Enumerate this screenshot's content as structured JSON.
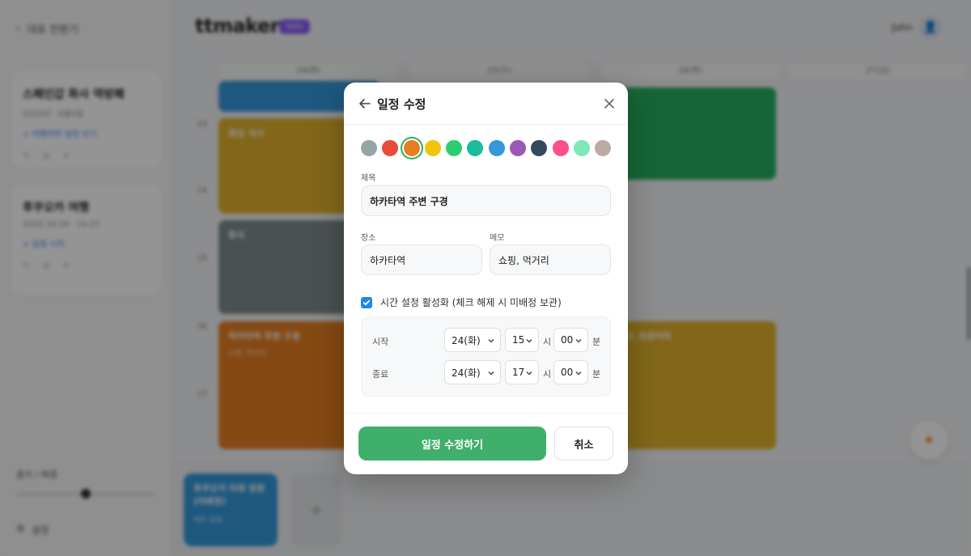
{
  "background": {
    "sidebar": {
      "back_label": "대표 전환기",
      "trips": [
        {
          "title": "스페인갑 화사 역방폐",
          "date": "2025년 · 8월9일",
          "link": "> 여행하면 일정 보기"
        },
        {
          "title": "후쿠오카 여행",
          "date": "2025.10.24 · 10.27",
          "link": "> 일정 시작"
        }
      ],
      "zoom_label": "출처 / 빠름",
      "settings_label": "설정"
    },
    "header": {
      "logo": "ttmaker",
      "badge": "beta",
      "user_name": "John"
    },
    "day_headers": [
      "24(화)",
      "25(수)",
      "26(목)",
      "27(금)"
    ],
    "time_labels": [
      "13",
      "14",
      "15",
      "16",
      "17"
    ],
    "events": [
      {
        "title": "",
        "sub": "",
        "color": "#3498db"
      },
      {
        "title": "점심 식사",
        "sub": "",
        "color": "#e1b12c"
      },
      {
        "title": "",
        "sub": "",
        "color": "#27ae60"
      },
      {
        "title": "휴식",
        "sub": "",
        "color": "#7f8c8d"
      },
      {
        "title": "하카타역 주변 구경",
        "sub": "쇼핑, 먹거리",
        "color": "#e67e22"
      },
      {
        "title": "나카스 포장마차",
        "sub": "",
        "color": "#e1b12c"
      }
    ],
    "tray": {
      "card_title": "후쿠오카 타워 방문 (미배정)",
      "card_sub": "메모 없음"
    }
  },
  "modal": {
    "title": "일정 수정",
    "colors": [
      "#95a5a6",
      "#e74c3c",
      "#e67e22",
      "#f1c40f",
      "#2ecc71",
      "#1abc9c",
      "#3498db",
      "#9b59b6",
      "#34495e",
      "#fd4f8c",
      "#7ee8b8",
      "#bcaaa4"
    ],
    "selected_color": "#e67e22",
    "title_label": "제목",
    "title_value": "하카타역 주변 구경",
    "location_label": "장소",
    "location_value": "하카타역",
    "memo_label": "메모",
    "memo_value": "쇼핑, 먹거리",
    "time_toggle_label": "시간 설정 활성화 (체크 해제 시 미배정 보관)",
    "time_toggle_checked": true,
    "start": {
      "label": "시작",
      "day": "24(화)",
      "hour": "15",
      "minute": "00"
    },
    "end": {
      "label": "종료",
      "day": "24(화)",
      "hour": "17",
      "minute": "00"
    },
    "hour_unit": "시",
    "minute_unit": "분",
    "submit_label": "일정 수정하기",
    "cancel_label": "취소",
    "accent_color": "#3faf6b"
  }
}
